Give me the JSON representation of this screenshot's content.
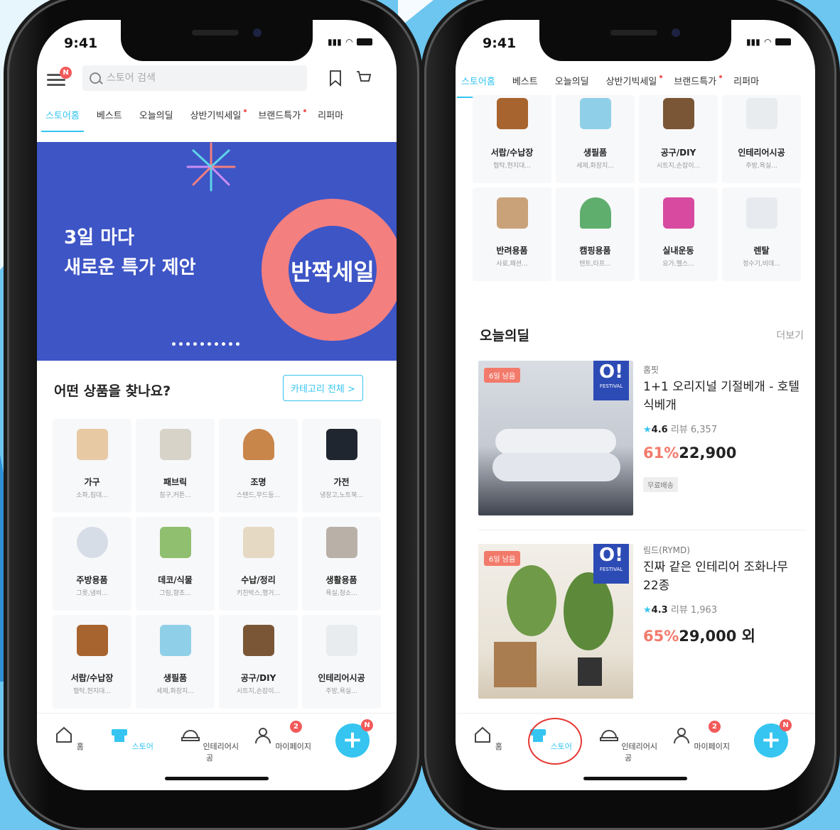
{
  "left_phone": {
    "status_time": "9:41",
    "menu_badge": "N",
    "search_placeholder": "스토어 검색",
    "tabs": [
      "스토어홈",
      "베스트",
      "오늘의딜",
      "상반기빅세일",
      "브랜드특가",
      "리퍼마"
    ],
    "banner": {
      "line1": "3일 마다",
      "line2": "새로운 특가 제안",
      "ring_text": "반짝세일"
    },
    "section_title": "어떤 상품을 찾나요?",
    "category_button": "카테고리 전체 >",
    "categories": [
      {
        "name": "가구",
        "sub": "소파,침대..."
      },
      {
        "name": "패브릭",
        "sub": "침구,커튼..."
      },
      {
        "name": "조명",
        "sub": "스탠드,무드등..."
      },
      {
        "name": "가전",
        "sub": "냉장고,노트북..."
      },
      {
        "name": "주방용품",
        "sub": "그릇,냄비..."
      },
      {
        "name": "데코/식물",
        "sub": "그림,향초..."
      },
      {
        "name": "수납/정리",
        "sub": "키친박스,행거..."
      },
      {
        "name": "생활용품",
        "sub": "욕실,청소..."
      },
      {
        "name": "서랍/수납장",
        "sub": "협탁,현지대..."
      },
      {
        "name": "생필품",
        "sub": "세제,화장지..."
      },
      {
        "name": "공구/DIY",
        "sub": "시트지,손잡이..."
      },
      {
        "name": "인테리어시공",
        "sub": "주방,욕실..."
      }
    ],
    "nav": [
      "홈",
      "스토어",
      "인테리어시공",
      "마이페이지"
    ],
    "nav_badge": "2",
    "fab_badge": "N"
  },
  "right_phone": {
    "status_time": "9:41",
    "tabs": [
      "스토어홈",
      "베스트",
      "오늘의딜",
      "상반기빅세일",
      "브랜드특가",
      "리퍼마"
    ],
    "categories": [
      {
        "name": "서랍/수납장",
        "sub": "협탁,현지대..."
      },
      {
        "name": "생필품",
        "sub": "세제,화장지..."
      },
      {
        "name": "공구/DIY",
        "sub": "시트지,손잡이..."
      },
      {
        "name": "인테리어시공",
        "sub": "주방,욕실..."
      },
      {
        "name": "반려용품",
        "sub": "사료,패션..."
      },
      {
        "name": "캠핑용품",
        "sub": "텐트,타프..."
      },
      {
        "name": "실내운동",
        "sub": "요가,헬스..."
      },
      {
        "name": "렌탈",
        "sub": "정수기,비데..."
      }
    ],
    "section_title": "오늘의딜",
    "more": "더보기",
    "deals": [
      {
        "tag": "6일 남음",
        "brand": "홈핏",
        "title": "1+1 오리지널 기절베개 - 호텔식베개",
        "rating": "4.6",
        "reviews": "리뷰 6,357",
        "pct": "61%",
        "price": "22,900",
        "ship": "무료배송",
        "festival": "FESTIVAL"
      },
      {
        "tag": "6일 남음",
        "brand": "림드(RYMD)",
        "title": "진짜 같은 인테리어 조화나무 22종",
        "rating": "4.3",
        "reviews": "리뷰 1,963",
        "pct": "65%",
        "price": "29,000 외",
        "festival": "FESTIVAL"
      }
    ],
    "nav": [
      "홈",
      "스토어",
      "인테리어시공",
      "마이페이지"
    ],
    "nav_badge": "2",
    "fab_badge": "N"
  }
}
